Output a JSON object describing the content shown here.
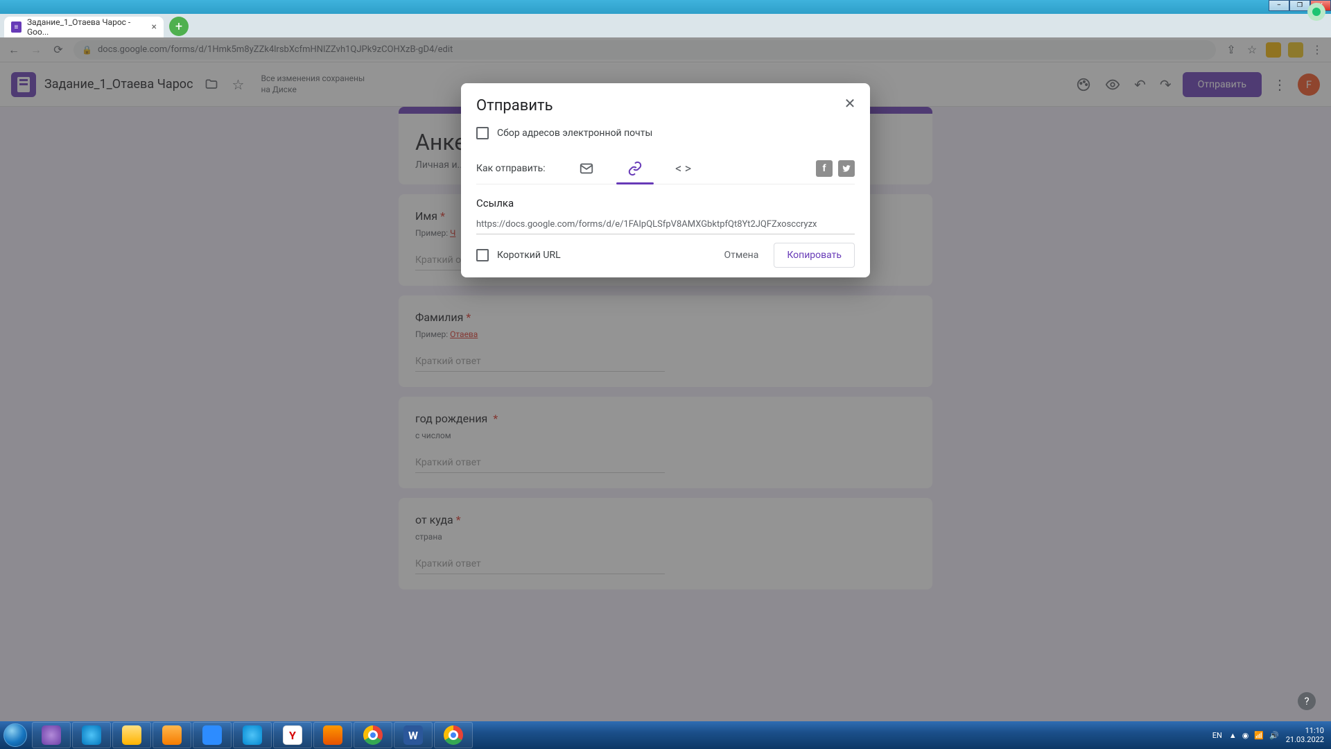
{
  "window": {
    "minimize": "–",
    "maximize": "❐",
    "close": "✕"
  },
  "browser": {
    "tab_title": "Задание_1_Отаева Чарос - Goo...",
    "tab_close": "×",
    "new_tab": "+",
    "url": "docs.google.com/forms/d/1Hmk5m8yZZk4lrsbXcfmHNlZZvh1QJPk9zCOHXzB-gD4/edit",
    "nav": {
      "back": "←",
      "forward": "→",
      "reload": "⟳"
    },
    "share": "⇪",
    "star": "☆",
    "menu": "⋮"
  },
  "header": {
    "doc_title": "Задание_1_Отаева Чарос",
    "folder": "▢",
    "star": "☆",
    "save_status_l1": "Все изменения сохранены",
    "save_status_l2": "на Диске",
    "palette": "🎨",
    "preview": "👁",
    "undo": "↶",
    "redo": "↷",
    "send": "Отправить",
    "menu": "⋮",
    "avatar": "F"
  },
  "form": {
    "title": "Анке",
    "desc": "Личная и...",
    "q1": {
      "title": "Имя",
      "desc_prefix": "Пример: ",
      "desc_link": "Ч",
      "placeholder": "Краткий ответ"
    },
    "q2": {
      "title": "Фамилия",
      "desc_prefix": "Пример: ",
      "desc_link": "Отаева",
      "placeholder": "Краткий ответ"
    },
    "q3": {
      "title": "год рождения",
      "desc": "с числом",
      "placeholder": "Краткий ответ"
    },
    "q4": {
      "title": "от куда",
      "desc": "страна",
      "placeholder": "Краткий ответ"
    }
  },
  "dialog": {
    "title": "Отправить",
    "close": "✕",
    "collect_emails": "Сбор адресов электронной почты",
    "send_via_label": "Как отправить:",
    "tabs": {
      "email": "✉",
      "link": "🔗",
      "embed": "< >"
    },
    "social": {
      "fb": "f",
      "tw": "t"
    },
    "section": "Ссылка",
    "link_value": "https://docs.google.com/forms/d/e/1FAIpQLSfpV8AMXGbktpfQt8Yt2JQFZxosccryzx",
    "short_url": "Короткий URL",
    "cancel": "Отмена",
    "copy": "Копировать"
  },
  "taskbar": {
    "lang": "EN",
    "time": "11:10",
    "date": "21.03.2022",
    "tray_arrow": "▲"
  },
  "help": "?"
}
